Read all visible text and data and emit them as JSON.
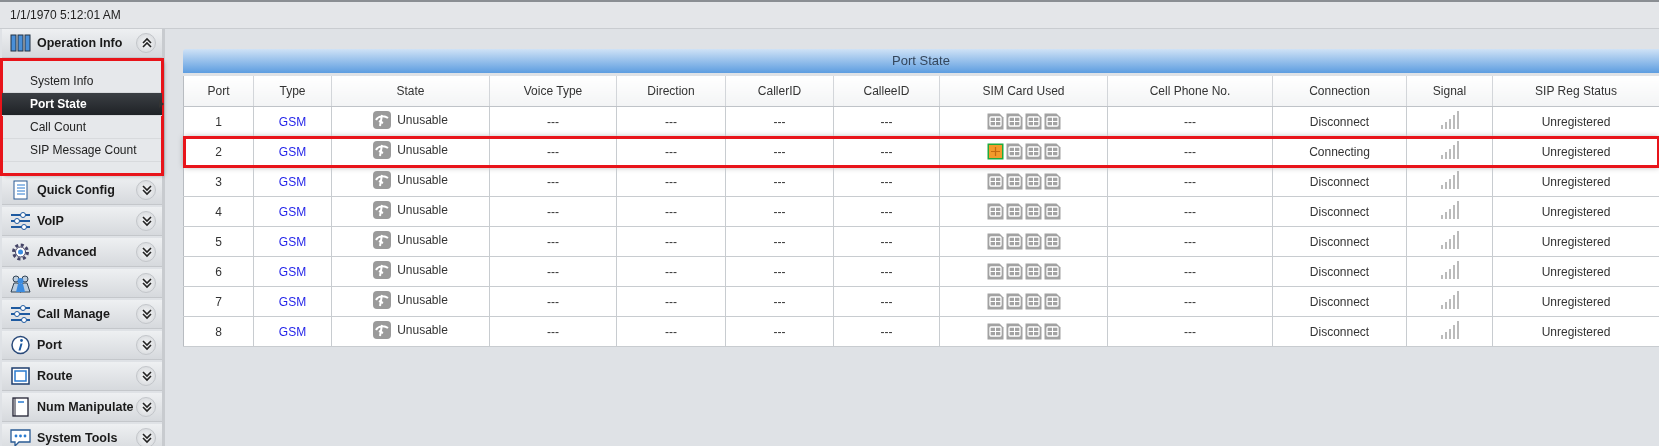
{
  "status_bar": {
    "datetime": "1/1/1970 5:12:01 AM"
  },
  "sidebar": {
    "groups": [
      {
        "label": "Operation Info",
        "expanded": true,
        "highlighted": true,
        "items": [
          {
            "label": "System Info",
            "selected": false
          },
          {
            "label": "Port State",
            "selected": true
          },
          {
            "label": "Call Count",
            "selected": false
          },
          {
            "label": "SIP Message Count",
            "selected": false
          }
        ]
      },
      {
        "label": "Quick Config",
        "expanded": false
      },
      {
        "label": "VoIP",
        "expanded": false
      },
      {
        "label": "Advanced",
        "expanded": false
      },
      {
        "label": "Wireless",
        "expanded": false
      },
      {
        "label": "Call Manage",
        "expanded": false
      },
      {
        "label": "Port",
        "expanded": false
      },
      {
        "label": "Route",
        "expanded": false
      },
      {
        "label": "Num Manipulate",
        "expanded": false
      },
      {
        "label": "System Tools",
        "expanded": false
      }
    ]
  },
  "panel": {
    "title": "Port State",
    "table": {
      "columns": [
        "Port",
        "Type",
        "State",
        "Voice Type",
        "Direction",
        "CallerID",
        "CalleeID",
        "SIM Card Used",
        "Cell Phone No.",
        "Connection",
        "Signal",
        "SIP Reg Status"
      ],
      "rows": [
        {
          "port": "1",
          "type": "GSM",
          "state": "Unusable",
          "voice_type": "---",
          "direction": "---",
          "caller_id": "---",
          "callee_id": "---",
          "sims": [
            {
              "active": false
            },
            {
              "active": false
            },
            {
              "active": false
            },
            {
              "active": false
            }
          ],
          "cell_phone": "---",
          "connection": "Disconnect",
          "sip_status": "Unregistered",
          "highlighted": false
        },
        {
          "port": "2",
          "type": "GSM",
          "state": "Unusable",
          "voice_type": "---",
          "direction": "---",
          "caller_id": "---",
          "callee_id": "---",
          "sims": [
            {
              "active": true
            },
            {
              "active": false
            },
            {
              "active": false
            },
            {
              "active": false
            }
          ],
          "cell_phone": "---",
          "connection": "Connecting",
          "sip_status": "Unregistered",
          "highlighted": true
        },
        {
          "port": "3",
          "type": "GSM",
          "state": "Unusable",
          "voice_type": "---",
          "direction": "---",
          "caller_id": "---",
          "callee_id": "---",
          "sims": [
            {
              "active": false
            },
            {
              "active": false
            },
            {
              "active": false
            },
            {
              "active": false
            }
          ],
          "cell_phone": "---",
          "connection": "Disconnect",
          "sip_status": "Unregistered",
          "highlighted": false
        },
        {
          "port": "4",
          "type": "GSM",
          "state": "Unusable",
          "voice_type": "---",
          "direction": "---",
          "caller_id": "---",
          "callee_id": "---",
          "sims": [
            {
              "active": false
            },
            {
              "active": false
            },
            {
              "active": false
            },
            {
              "active": false
            }
          ],
          "cell_phone": "---",
          "connection": "Disconnect",
          "sip_status": "Unregistered",
          "highlighted": false
        },
        {
          "port": "5",
          "type": "GSM",
          "state": "Unusable",
          "voice_type": "---",
          "direction": "---",
          "caller_id": "---",
          "callee_id": "---",
          "sims": [
            {
              "active": false
            },
            {
              "active": false
            },
            {
              "active": false
            },
            {
              "active": false
            }
          ],
          "cell_phone": "---",
          "connection": "Disconnect",
          "sip_status": "Unregistered",
          "highlighted": false
        },
        {
          "port": "6",
          "type": "GSM",
          "state": "Unusable",
          "voice_type": "---",
          "direction": "---",
          "caller_id": "---",
          "callee_id": "---",
          "sims": [
            {
              "active": false
            },
            {
              "active": false
            },
            {
              "active": false
            },
            {
              "active": false
            }
          ],
          "cell_phone": "---",
          "connection": "Disconnect",
          "sip_status": "Unregistered",
          "highlighted": false
        },
        {
          "port": "7",
          "type": "GSM",
          "state": "Unusable",
          "voice_type": "---",
          "direction": "---",
          "caller_id": "---",
          "callee_id": "---",
          "sims": [
            {
              "active": false
            },
            {
              "active": false
            },
            {
              "active": false
            },
            {
              "active": false
            }
          ],
          "cell_phone": "---",
          "connection": "Disconnect",
          "sip_status": "Unregistered",
          "highlighted": false
        },
        {
          "port": "8",
          "type": "GSM",
          "state": "Unusable",
          "voice_type": "---",
          "direction": "---",
          "caller_id": "---",
          "callee_id": "---",
          "sims": [
            {
              "active": false
            },
            {
              "active": false
            },
            {
              "active": false
            },
            {
              "active": false
            }
          ],
          "cell_phone": "---",
          "connection": "Disconnect",
          "sip_status": "Unregistered",
          "highlighted": false
        }
      ]
    }
  }
}
